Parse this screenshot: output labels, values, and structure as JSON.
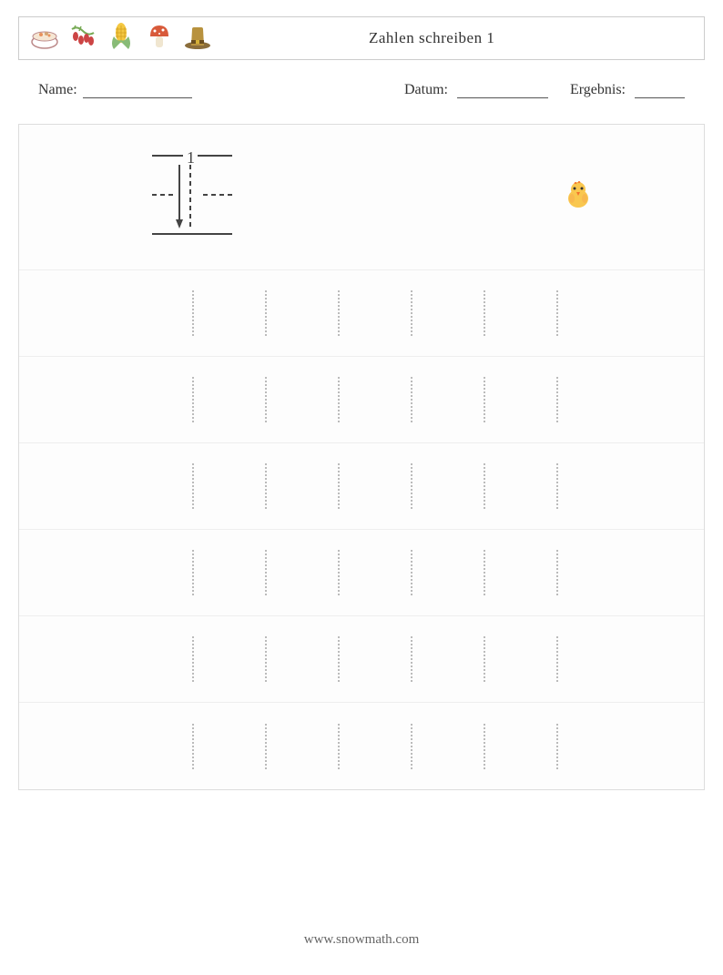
{
  "header": {
    "title": "Zahlen schreiben 1",
    "icons": [
      "bowl-icon",
      "berries-icon",
      "corn-icon",
      "mushroom-icon",
      "pilgrim-hat-icon"
    ]
  },
  "info": {
    "name_label": "Name:",
    "date_label": "Datum:",
    "result_label": "Ergebnis:"
  },
  "worksheet": {
    "practice_rows": 6,
    "cells_per_row": 6,
    "demo_number": "1"
  },
  "footer": {
    "url": "www.snowmath.com"
  }
}
